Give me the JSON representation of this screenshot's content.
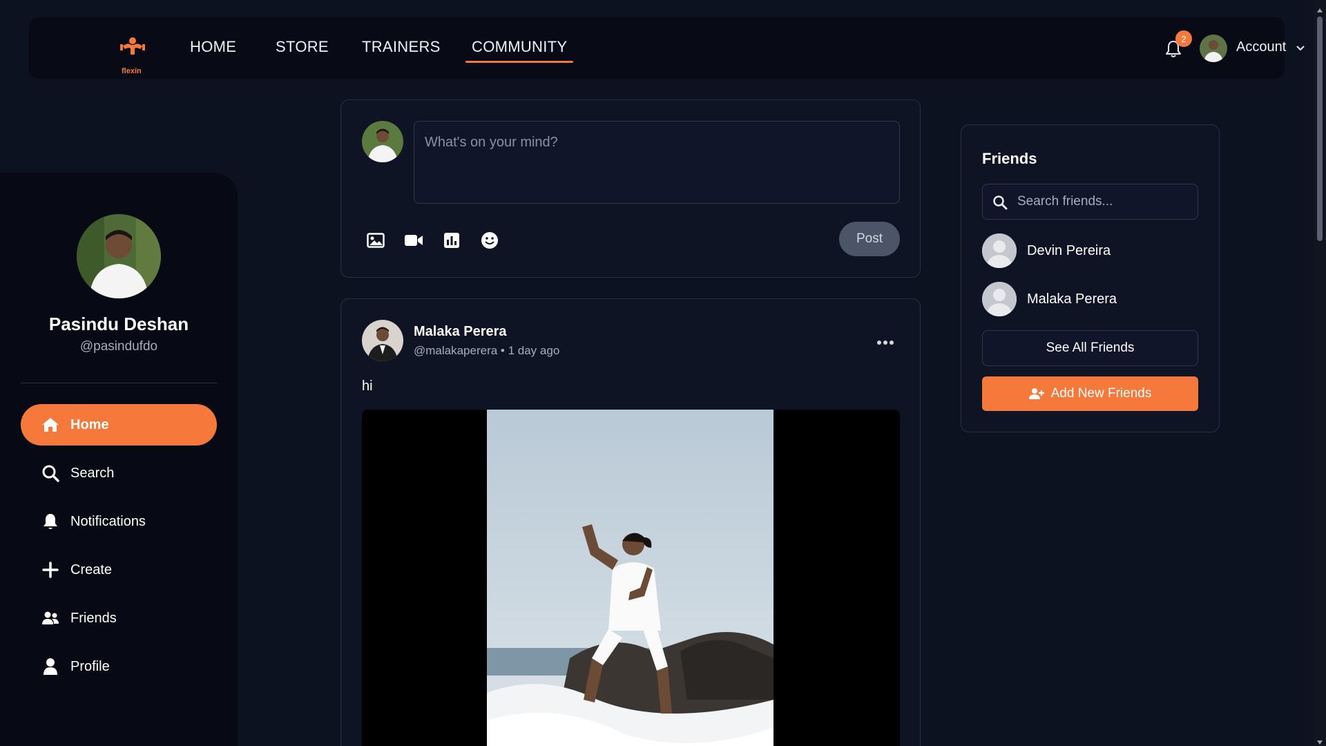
{
  "nav": {
    "brand": "flexin",
    "links": [
      "HOME",
      "STORE",
      "TRAINERS",
      "COMMUNITY"
    ],
    "active_link": "COMMUNITY",
    "notification_count": "2",
    "account_label": "Account"
  },
  "sidebar": {
    "user_name": "Pasindu Deshan",
    "user_handle": "@pasindufdo",
    "items": [
      {
        "label": "Home",
        "icon": "home-icon",
        "active": true
      },
      {
        "label": "Search",
        "icon": "search-icon",
        "active": false
      },
      {
        "label": "Notifications",
        "icon": "bell-icon",
        "active": false
      },
      {
        "label": "Create",
        "icon": "plus-icon",
        "active": false
      },
      {
        "label": "Friends",
        "icon": "users-icon",
        "active": false
      },
      {
        "label": "Profile",
        "icon": "user-icon",
        "active": false
      }
    ]
  },
  "composer": {
    "placeholder": "What's on your mind?",
    "tools": [
      "image-icon",
      "video-icon",
      "poll-icon",
      "emoji-icon"
    ],
    "post_label": "Post"
  },
  "post": {
    "author": "Malaka Perera",
    "handle": "@malakaperera",
    "time": "1 day ago",
    "meta": "@malakaperera • 1 day ago",
    "text": "hi"
  },
  "friends": {
    "title": "Friends",
    "search_placeholder": "Search friends...",
    "list": [
      {
        "name": "Devin Pereira"
      },
      {
        "name": "Malaka Perera"
      }
    ],
    "see_all_label": "See All Friends",
    "add_new_label": "Add New Friends"
  },
  "colors": {
    "accent": "#f5793b",
    "background": "#0d1221",
    "card": "#0f1424",
    "sidebar": "#070a14"
  }
}
